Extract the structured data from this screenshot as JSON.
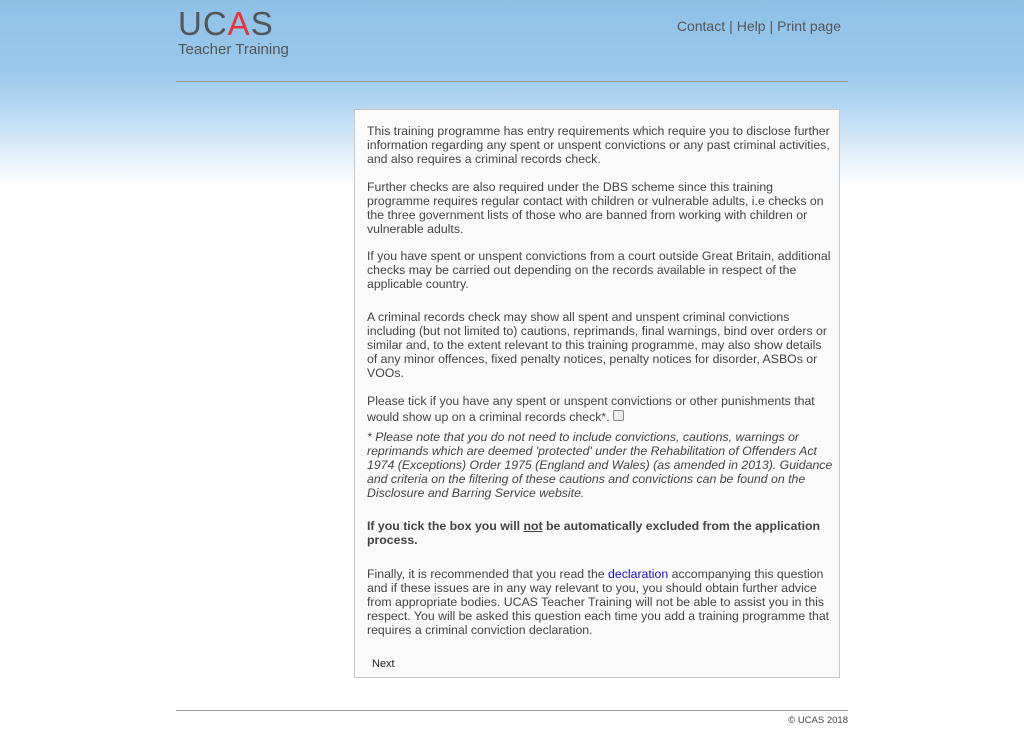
{
  "header": {
    "logo_main_pre": "UC",
    "logo_main_accent": "A",
    "logo_main_post": "S",
    "logo_sub": "Teacher Training",
    "links": [
      "Contact",
      "Help",
      "Print page"
    ],
    "separator": "|"
  },
  "content": {
    "p1": "This training programme has entry requirements which require you to disclose further information regarding any spent or unspent convictions or any past criminal activities, and also requires a criminal records check.",
    "p2": "Further checks are also required under the DBS scheme since this training programme requires regular contact with children or vulnerable adults, i.e checks on the three government lists of those who are banned from working with children or vulnerable adults.",
    "p3": "If you have spent or unspent convictions from a court outside Great Britain, additional checks may be carried out depending on the records available in respect of the applicable country.",
    "p4": "A criminal records check may show all spent and unspent criminal convictions including (but not limited to) cautions, reprimands, final warnings, bind over orders or similar and, to the extent relevant to this training programme, may also show details of any minor offences, fixed penalty notices, penalty notices for disorder, ASBOs or VOOs.",
    "p5": "Please tick if you have any spent or unspent convictions or other punishments that would show up on a criminal records check*.",
    "checkbox_checked": false,
    "note": "* Please note that you do not need to include convictions, cautions, warnings or reprimands which are deemed 'protected' under the Rehabilitation of Offenders Act 1974 (Exceptions) Order 1975 (England and Wales) (as amended in 2013). Guidance and criteria on the filtering of these cautions and convictions can be found on the Disclosure and Barring Service website.",
    "bold_pre": "If you tick the box you will ",
    "bold_underlined": "not",
    "bold_post": " be automatically excluded from the application process.",
    "final_pre": "Finally, it is recommended that you read the ",
    "final_link": "declaration",
    "final_post": " accompanying this question and if these issues are in any way relevant to you, you should obtain further advice from appropriate bodies. UCAS Teacher Training will not be able to assist you in this respect. You will be asked this question each time you add a training programme that requires a criminal conviction declaration.",
    "next_label": "Next"
  },
  "footer": {
    "copyright": "© UCAS 2018"
  },
  "colors": {
    "header_blue": "#8fc1e8",
    "logo_accent": "#e8323c",
    "link_blue": "#1a0dcc"
  }
}
